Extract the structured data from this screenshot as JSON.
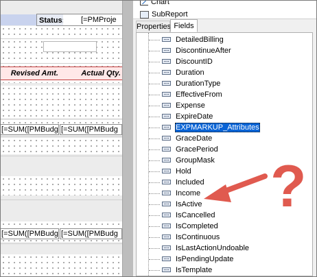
{
  "designer": {
    "status_label": "Status:",
    "status_value": "[=PMProje",
    "column_headers": [
      "Revised Amt.",
      "Actual Qty."
    ],
    "sum_row_1": [
      "[=SUM([PMBudg",
      "[=SUM([PMBudg"
    ],
    "sum_row_2": [
      "[=SUM([PMBudg",
      "[=SUM([PMBudg"
    ]
  },
  "toolbox": {
    "items": [
      "Chart",
      "SubReport"
    ]
  },
  "tabs": [
    "Properties",
    "Fields"
  ],
  "active_tab": "Fields",
  "fields": [
    "DetailedBilling",
    "DiscontinueAfter",
    "DiscountID",
    "Duration",
    "DurationType",
    "EffectiveFrom",
    "Expense",
    "ExpireDate",
    "EXPMARKUP_Attributes",
    "GraceDate",
    "GracePeriod",
    "GroupMask",
    "Hold",
    "Included",
    "Income",
    "IsActive",
    "IsCancelled",
    "IsCompleted",
    "IsContinuous",
    "IsLastActionUndoable",
    "IsPendingUpdate",
    "IsTemplate"
  ],
  "selected_field": "EXPMARKUP_Attributes",
  "annotation": {
    "mark": "?",
    "color": "#e05a4f"
  }
}
